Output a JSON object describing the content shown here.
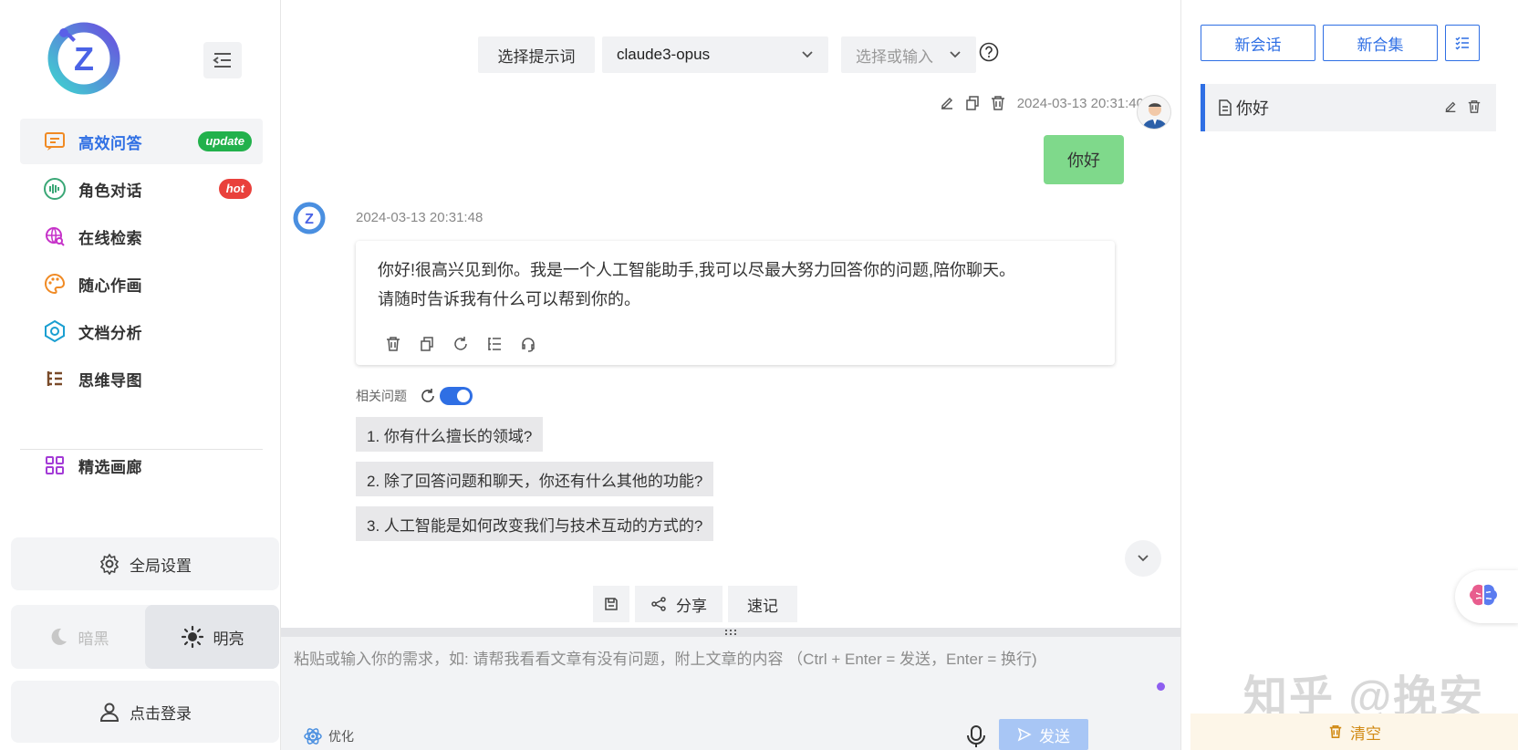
{
  "sidebar": {
    "logo_letter": "Z",
    "nav": [
      {
        "label": "高效问答",
        "badge": "update",
        "icon": "chat-icon",
        "active": true
      },
      {
        "label": "角色对话",
        "badge": "hot",
        "icon": "voice-wave-icon"
      },
      {
        "label": "在线检索",
        "icon": "web-search-icon"
      },
      {
        "label": "随心作画",
        "icon": "palette-icon"
      },
      {
        "label": "文档分析",
        "icon": "document-analysis-icon"
      },
      {
        "label": "思维导图",
        "icon": "mindmap-icon"
      }
    ],
    "gallery_label": "精选画廊",
    "settings_label": "全局设置",
    "theme": {
      "dark_label": "暗黑",
      "light_label": "明亮",
      "selected": "light"
    },
    "login_label": "点击登录"
  },
  "topbar": {
    "prompt_label": "选择提示词",
    "model_value": "claude3-opus",
    "param_placeholder": "选择或输入"
  },
  "chat": {
    "user_time": "2024-03-13 20:31:40",
    "user_message": "你好",
    "bot_time": "2024-03-13 20:31:48",
    "bot_line1": "你好!很高兴见到你。我是一个人工智能助手,我可以尽最大努力回答你的问题,陪你聊天。",
    "bot_line2": "请随时告诉我有什么可以帮到你的。",
    "related_label": "相关问题",
    "suggestions": [
      "1. 你有什么擅长的领域?",
      "2. 除了回答问题和聊天，你还有什么其他的功能?",
      "3. 人工智能是如何改变我们与技术互动的方式的?"
    ],
    "share_label": "分享",
    "notes_label": "速记"
  },
  "input": {
    "placeholder": "粘贴或输入你的需求，如: 请帮我看看文章有没有问题，附上文章的内容 （Ctrl + Enter = 发送，Enter = 换行)",
    "optimize_label": "优化",
    "send_label": "发送"
  },
  "right": {
    "new_chat_label": "新会话",
    "new_collection_label": "新合集",
    "conversations": [
      {
        "title": "你好"
      }
    ],
    "clear_label": "清空",
    "watermark": "知乎 @挽安"
  },
  "colors": {
    "accent": "#2f6fe4",
    "user_bubble": "#7fd98b",
    "send_disabled": "#a8c6f5",
    "clear_text": "#d18a14"
  }
}
